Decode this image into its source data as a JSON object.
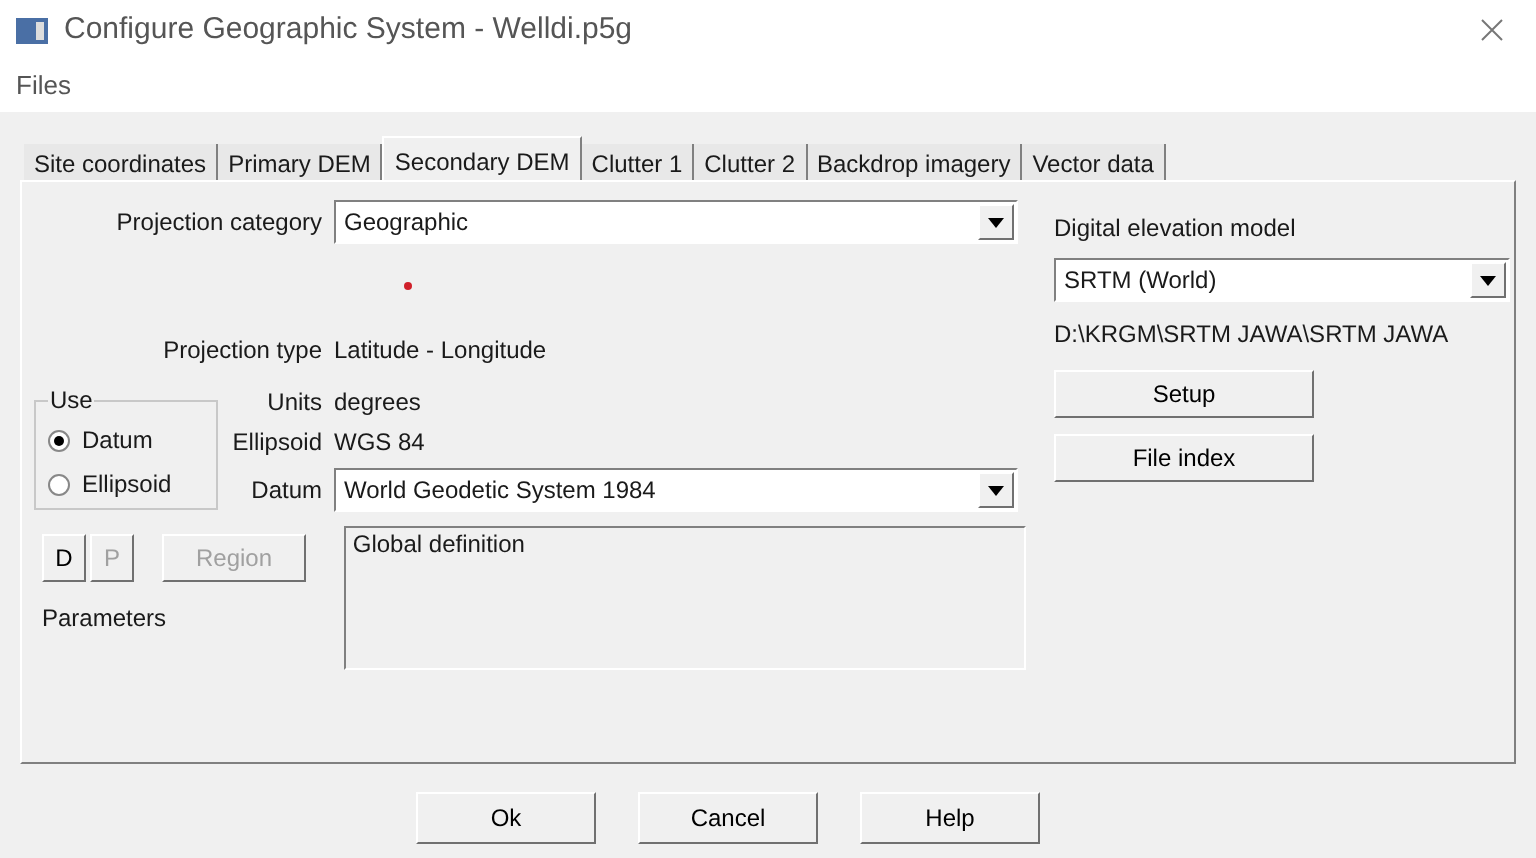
{
  "window": {
    "title": "Configure Geographic System - Welldi.p5g"
  },
  "menu": [
    "Files"
  ],
  "tabs": [
    {
      "label": "Site coordinates",
      "selected": false
    },
    {
      "label": "Primary DEM",
      "selected": false
    },
    {
      "label": "Secondary DEM",
      "selected": true
    },
    {
      "label": "Clutter 1",
      "selected": false
    },
    {
      "label": "Clutter 2",
      "selected": false
    },
    {
      "label": "Backdrop imagery",
      "selected": false
    },
    {
      "label": "Vector data",
      "selected": false
    }
  ],
  "projection_category": {
    "label": "Projection category",
    "value": "Geographic"
  },
  "marker": {
    "color": "#d0202a"
  },
  "projection_type": {
    "label": "Projection type",
    "value": "Latitude - Longitude"
  },
  "units": {
    "label": "Units",
    "value": "degrees"
  },
  "ellipsoid": {
    "label": "Ellipsoid",
    "value": "WGS 84"
  },
  "datum": {
    "label": "Datum",
    "value": "World Geodetic System 1984"
  },
  "use_group": {
    "title": "Use",
    "options": [
      {
        "label": "Datum",
        "selected": true
      },
      {
        "label": "Ellipsoid",
        "selected": false
      }
    ]
  },
  "parameter_buttons": [
    {
      "label": "D",
      "disabled": false
    },
    {
      "label": "P",
      "disabled": true
    },
    {
      "label": "Region",
      "disabled": true
    }
  ],
  "parameters_label": "Parameters",
  "description": "Global definition",
  "dem": {
    "label": "Digital elevation model",
    "value": "SRTM (World)",
    "path": "D:\\KRGM\\SRTM JAWA\\SRTM JAWA",
    "buttons": [
      "Setup",
      "File index"
    ]
  },
  "footer_buttons": [
    "Ok",
    "Cancel",
    "Help"
  ]
}
